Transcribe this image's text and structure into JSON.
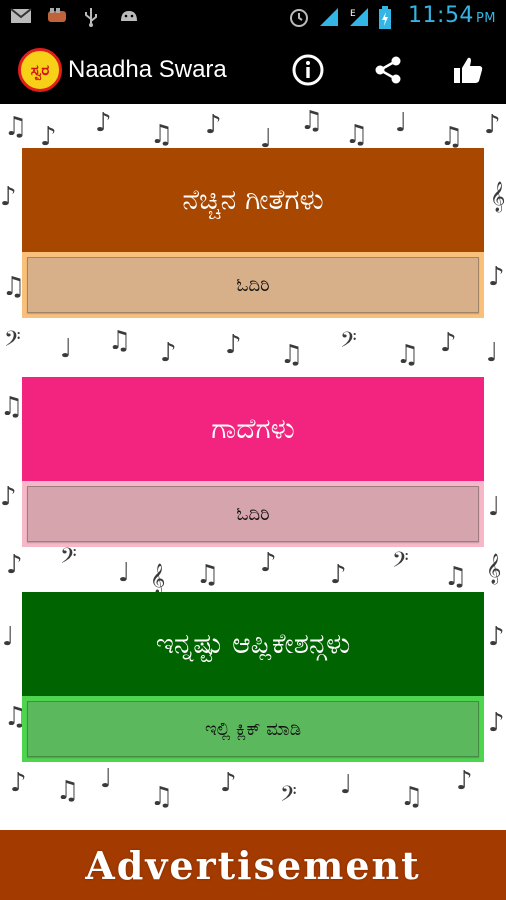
{
  "status_bar": {
    "time": "11:54",
    "ampm": "PM",
    "left_icons": [
      "gmail-icon",
      "app-icon",
      "usb-icon",
      "android-icon"
    ],
    "right_icons": [
      "alarm-icon",
      "signal-icon",
      "network-e-icon",
      "battery-icon"
    ]
  },
  "action_bar": {
    "logo_text": "ಸ್ವರ",
    "title": "Naadha Swara",
    "actions": [
      "info-icon",
      "share-icon",
      "like-icon"
    ]
  },
  "cards": [
    {
      "title": "ನೆಚ್ಚಿನ ಗೀತೆಗಳು",
      "button": "ಓದಿರಿ",
      "head_color": "#a84800",
      "foot_color": "#f8c07a",
      "button_color": "#d7b08a"
    },
    {
      "title": "ಗಾದೆಗಳು",
      "button": "ಓದಿರಿ",
      "head_color": "#f2247f",
      "foot_color": "#f4b8c8",
      "button_color": "#d6a4ad"
    },
    {
      "title": "ಇನ್ನಷ್ಟು ಆಪ್ಲಿಕೇಶನ್ಗಳು",
      "button": "ಇಲ್ಲಿ ಕ್ಲಿಕ್ ಮಾಡಿ",
      "head_color": "#006400",
      "foot_color": "#4fd44f",
      "button_color": "#5cb85c"
    }
  ],
  "ad_banner": {
    "text": "Advertisement"
  }
}
